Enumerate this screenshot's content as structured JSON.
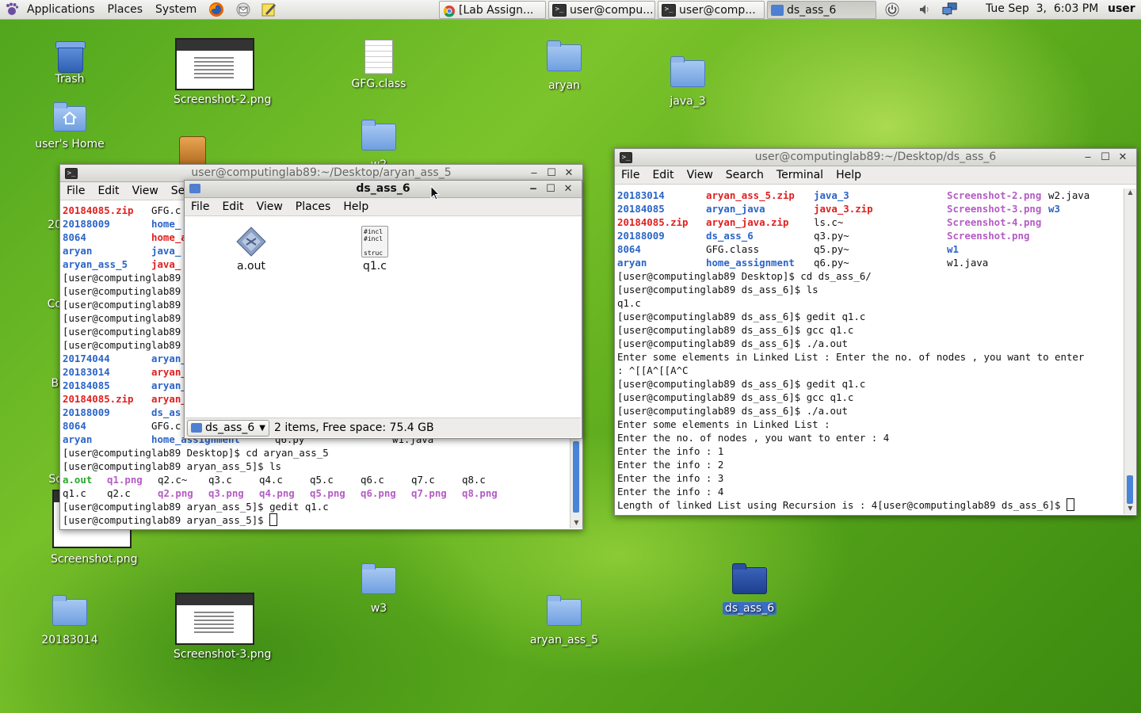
{
  "panel": {
    "menus": [
      "Applications",
      "Places",
      "System"
    ],
    "tasks": [
      {
        "label": "[Lab Assign...",
        "icon": "chrome-icon"
      },
      {
        "label": "user@compu...",
        "icon": "terminal-icon"
      },
      {
        "label": "user@comp...",
        "icon": "terminal-icon"
      },
      {
        "label": "ds_ass_6",
        "icon": "folder-icon"
      }
    ],
    "clock": "Tue Sep  3,  6:03 PM",
    "user": "user"
  },
  "desktop_icons": {
    "trash": "Trash",
    "screenshot2": "Screenshot-2.png",
    "gfg_class": "GFG.class",
    "aryan": "aryan",
    "java_3": "java_3",
    "users_home": "user's Home",
    "w3": "w3",
    "ds_ass_6": "ds_ass_6",
    "screenshot": "Screenshot.png",
    "n20183014": "20183014",
    "screenshot3": "Screenshot-3.png",
    "aryan_ass_5": "aryan_ass_5",
    "partial_20": "20",
    "partial_co": "Co",
    "partial_bl": "Bl",
    "partial_sc": "Sc",
    "partial_w2": "w2"
  },
  "terminal_left": {
    "title": "user@computinglab89:~/Desktop/aryan_ass_5",
    "menus": [
      "File",
      "Edit",
      "View",
      "Sea"
    ],
    "ls1": [
      [
        "20184085.zip",
        "GFG.c"
      ],
      [
        "20188009",
        "home_"
      ],
      [
        "8064",
        "home_a"
      ],
      [
        "aryan",
        "java_"
      ],
      [
        "aryan_ass_5",
        "java_"
      ]
    ],
    "prompts": [
      "[user@computinglab89",
      "[user@computinglab89",
      "[user@computinglab89",
      "[user@computinglab89",
      "[user@computinglab89",
      "[user@computinglab89"
    ],
    "ls2": [
      [
        "20174044",
        "aryan_"
      ],
      [
        "20183014",
        "aryan_"
      ],
      [
        "20184085",
        "aryan_"
      ],
      [
        "20184085.zip",
        "aryan_"
      ],
      [
        "20188009",
        "ds_as"
      ],
      [
        "8064",
        "GFG.c"
      ],
      [
        "aryan",
        "home_assignment",
        "q6.py",
        "w1.java"
      ]
    ],
    "cmd_cd": "[user@computinglab89 Desktop]$ cd aryan_ass_5",
    "cmd_ls": "[user@computinglab89 aryan_ass_5]$ ls",
    "files_row1": [
      "a.out",
      "q1.png",
      "q2.c~",
      "q3.c",
      "q4.c",
      "q5.c",
      "q6.c",
      "q7.c",
      "q8.c"
    ],
    "files_row2": [
      "q1.c",
      "q2.c",
      "q2.png",
      "q3.png",
      "q4.png",
      "q5.png",
      "q6.png",
      "q7.png",
      "q8.png"
    ],
    "cmd_gedit": "[user@computinglab89 aryan_ass_5]$ gedit q1.c",
    "cmd_prompt": "[user@computinglab89 aryan_ass_5]$ "
  },
  "file_manager": {
    "title": "ds_ass_6",
    "menus": [
      "File",
      "Edit",
      "View",
      "Places",
      "Help"
    ],
    "items": [
      {
        "name": "a.out",
        "icon": "executable-icon"
      },
      {
        "name": "q1.c",
        "icon": "c-source-icon",
        "preview": [
          "#incl",
          "#incl",
          "",
          "struc"
        ]
      }
    ],
    "location": "ds_ass_6",
    "status": "2 items, Free space: 75.4 GB"
  },
  "terminal_right": {
    "title": "user@computinglab89:~/Desktop/ds_ass_6",
    "menus": [
      "File",
      "Edit",
      "View",
      "Search",
      "Terminal",
      "Help"
    ],
    "ls_rows": [
      [
        "20183014",
        "aryan_ass_5.zip",
        "java_3",
        "Screenshot-2.png",
        "w2.java"
      ],
      [
        "20184085",
        "aryan_java",
        "java_3.zip",
        "Screenshot-3.png",
        "w3"
      ],
      [
        "20184085.zip",
        "aryan_java.zip",
        "ls.c~",
        "Screenshot-4.png",
        ""
      ],
      [
        "20188009",
        "ds_ass_6",
        "q3.py~",
        "Screenshot.png",
        ""
      ],
      [
        "8064",
        "GFG.class",
        "q5.py~",
        "w1",
        ""
      ],
      [
        "aryan",
        "home_assignment",
        "q6.py~",
        "w1.java",
        ""
      ]
    ],
    "lines": [
      "[user@computinglab89 Desktop]$ cd ds_ass_6/",
      "[user@computinglab89 ds_ass_6]$ ls",
      "q1.c",
      "[user@computinglab89 ds_ass_6]$ gedit q1.c",
      "[user@computinglab89 ds_ass_6]$ gcc q1.c",
      "[user@computinglab89 ds_ass_6]$ ./a.out",
      "Enter some elements in Linked List : Enter the no. of nodes , you want to enter",
      ": ^[[A^[[A^C",
      "[user@computinglab89 ds_ass_6]$ gedit q1.c",
      "[user@computinglab89 ds_ass_6]$ gcc q1.c",
      "[user@computinglab89 ds_ass_6]$ ./a.out",
      "Enter some elements in Linked List :",
      "Enter the no. of nodes , you want to enter : 4",
      "Enter the info : 1",
      "Enter the info : 2",
      "Enter the info : 3",
      "Enter the info : 4",
      "Length of linked List using Recursion is : 4[user@computinglab89 ds_ass_6]$ "
    ]
  }
}
